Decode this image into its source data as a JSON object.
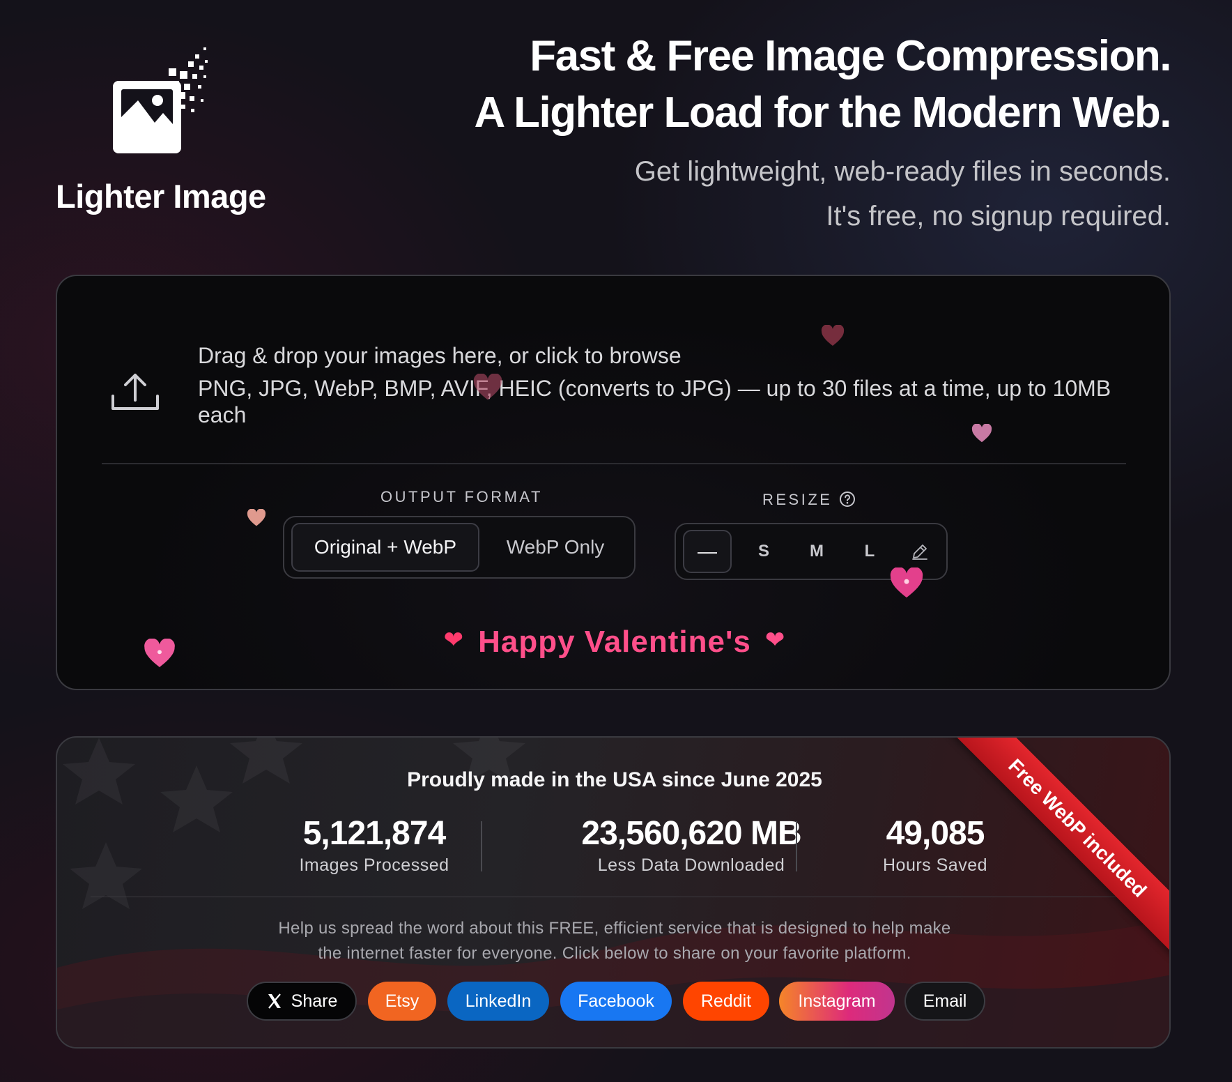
{
  "brand": {
    "name": "Lighter Image",
    "logo_icon": "image-pixel-dissolve-icon"
  },
  "hero": {
    "headline_1": "Fast & Free Image Compression.",
    "headline_2": "A Lighter Load for the Modern Web.",
    "sub_1": "Get lightweight, web-ready files in seconds.",
    "sub_2": "It's free, no signup required."
  },
  "upload": {
    "icon": "upload-icon",
    "title": "Drag & drop your images here, or click to browse",
    "hint": "PNG, JPG, WebP, BMP, AVIF, HEIC (converts to JPG) — up to 30 files at a time, up to 10MB each"
  },
  "output_format": {
    "label": "OUTPUT FORMAT",
    "options": [
      "Original + WebP",
      "WebP Only"
    ],
    "selected": "Original + WebP"
  },
  "resize": {
    "label": "RESIZE",
    "help_icon": "question-circle-icon",
    "options": [
      "—",
      "S",
      "M",
      "L"
    ],
    "custom_icon": "pencil-icon",
    "selected": "—"
  },
  "valentine": {
    "text": "Happy Valentine's",
    "heart_glyph": "❤"
  },
  "stats": {
    "made_in": "Proudly made in the USA since June 2025",
    "items": [
      {
        "value": "5,121,874",
        "label": "Images Processed"
      },
      {
        "value": "23,560,620 MB",
        "label": "Less Data Downloaded"
      },
      {
        "value": "49,085",
        "label": "Hours Saved"
      }
    ],
    "spread_1": "Help us spread the word about this FREE, efficient service that is designed to help make",
    "spread_2": "the internet faster for everyone. Click below to share on your favorite platform.",
    "ribbon": "Free WebP included"
  },
  "share": {
    "x": "Share",
    "etsy": "Etsy",
    "linkedin": "LinkedIn",
    "facebook": "Facebook",
    "reddit": "Reddit",
    "instagram": "Instagram",
    "email": "Email"
  },
  "colors": {
    "accent_pink": "#ff4f8a",
    "etsy": "#f16521",
    "linkedin": "#0a66c2",
    "facebook": "#1877f2",
    "reddit": "#ff4500",
    "ribbon": "#d11f26"
  }
}
